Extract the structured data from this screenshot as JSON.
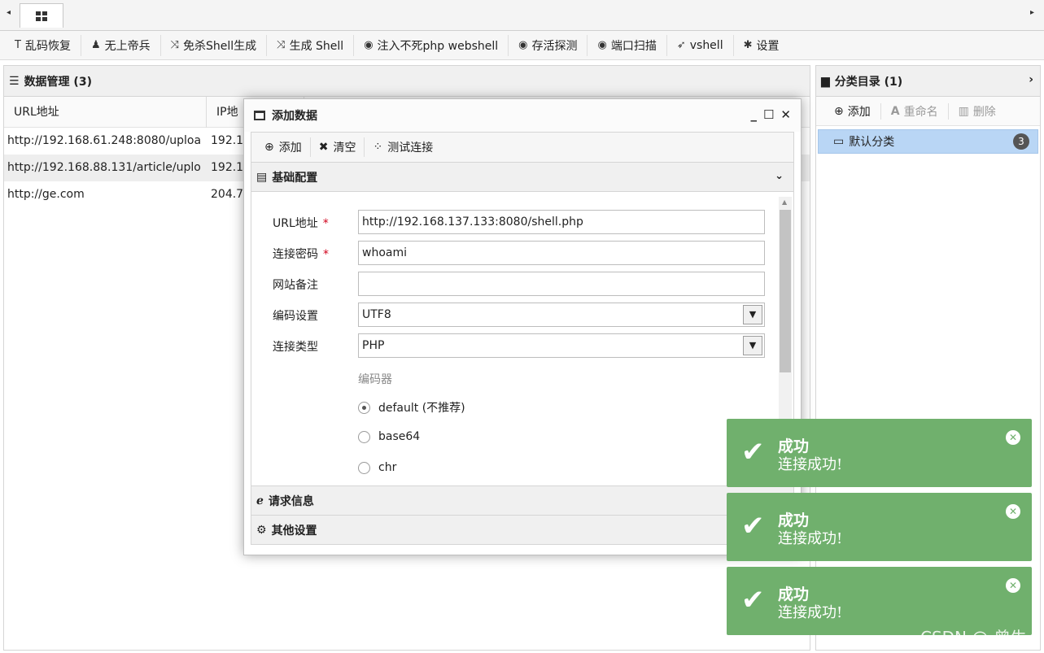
{
  "tabstrip": {
    "left_arrow": "◂",
    "right_arrow": "▸"
  },
  "toolbar": {
    "items": [
      {
        "icon": "text-cursor-icon",
        "glyph": "T",
        "label": "乱码恢复"
      },
      {
        "icon": "person-icon",
        "glyph": "♟",
        "label": "无上帝兵"
      },
      {
        "icon": "shuffle-icon",
        "glyph": "⤨",
        "label": "免杀Shell生成"
      },
      {
        "icon": "shuffle-icon",
        "glyph": "⤨",
        "label": "生成 Shell"
      },
      {
        "icon": "eye-icon",
        "glyph": "◉",
        "label": "注入不死php webshell"
      },
      {
        "icon": "eye-icon",
        "glyph": "◉",
        "label": "存活探测"
      },
      {
        "icon": "eye-icon",
        "glyph": "◉",
        "label": "端口扫描"
      },
      {
        "icon": "rocket-icon",
        "glyph": "➶",
        "label": "vshell"
      },
      {
        "icon": "gear-icon",
        "glyph": "✱",
        "label": "设置"
      }
    ]
  },
  "left_panel": {
    "title": "数据管理 (3)",
    "columns": [
      "URL地址",
      "IP地"
    ],
    "rows": [
      {
        "url": "http://192.168.61.248:8080/uploa",
        "ip": "192.1"
      },
      {
        "url": "http://192.168.88.131/article/uplo",
        "ip": "192.1"
      },
      {
        "url": "http://ge.com",
        "ip": "204.7"
      }
    ]
  },
  "right_panel": {
    "title": "分类目录 (1)",
    "toolbar": {
      "add": "添加",
      "rename": "重命名",
      "delete": "删除"
    },
    "categories": [
      {
        "label": "默认分类",
        "count": "3"
      }
    ]
  },
  "dialog": {
    "title": "添加数据",
    "toolbar": {
      "add": "添加",
      "clear": "清空",
      "test": "测试连接"
    },
    "section_basic": "基础配置",
    "fields": {
      "url_label": "URL地址",
      "url_value": "http://192.168.137.133:8080/shell.php",
      "password_label": "连接密码",
      "password_value": "whoami",
      "note_label": "网站备注",
      "note_value": "",
      "encoding_label": "编码设置",
      "encoding_value": "UTF8",
      "type_label": "连接类型",
      "type_value": "PHP",
      "required_mark": "*"
    },
    "encoder_label": "编码器",
    "encoders": [
      {
        "label": "default (不推荐)",
        "selected": true
      },
      {
        "label": "base64",
        "selected": false
      },
      {
        "label": "chr",
        "selected": false
      }
    ],
    "section_request": "请求信息",
    "section_other": "其他设置"
  },
  "toasts": [
    {
      "title": "成功",
      "message": "连接成功!"
    },
    {
      "title": "成功",
      "message": "连接成功!"
    },
    {
      "title": "成功",
      "message": "连接成功!"
    }
  ],
  "watermark": "CSDN @-曾牛",
  "colors": {
    "toast_bg": "#70b06d",
    "category_selected": "#b9d6f5"
  }
}
